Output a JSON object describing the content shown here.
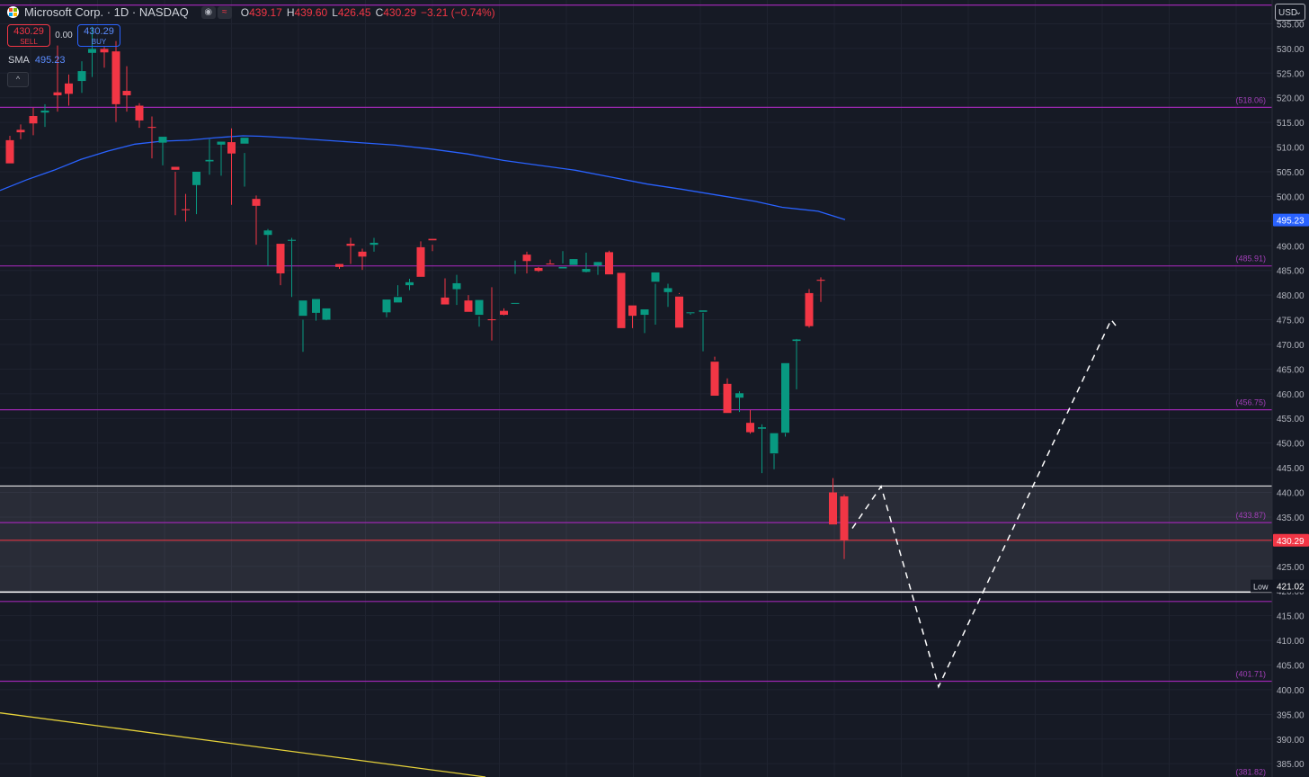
{
  "header": {
    "symbol": "Microsoft Corp. · 1D · NASDAQ",
    "open_label": "O",
    "open": "439.17",
    "high_label": "H",
    "high": "439.60",
    "low_label": "L",
    "low": "426.45",
    "close_label": "C",
    "close": "430.29",
    "change": "−3.21 (−0.74%)"
  },
  "trade": {
    "sell_price": "430.29",
    "sell_label": "SELL",
    "spread": "0.00",
    "buy_price": "430.29",
    "buy_label": "BUY"
  },
  "indicator": {
    "name": "SMA",
    "value": "495.23"
  },
  "currency": "USD",
  "colors": {
    "background": "#161a25",
    "grid": "#1f2330",
    "up": "#089981",
    "down": "#f23645",
    "sma": "#2962ff",
    "level": "#9c27b0",
    "trend": "#e6d23a"
  },
  "chart_data": {
    "type": "candlestick",
    "ylim": [
      382.3,
      539.8
    ],
    "y_ticks": [
      385,
      390,
      395,
      400,
      405,
      410,
      415,
      420,
      425,
      430,
      435,
      440,
      445,
      450,
      455,
      460,
      465,
      470,
      475,
      480,
      485,
      490,
      495,
      500,
      505,
      510,
      515,
      520,
      525,
      530,
      535
    ],
    "candles": [
      [
        511.4,
        512.3,
        507.2,
        506.7
      ],
      [
        513.5,
        514.6,
        511.6,
        513.0
      ],
      [
        516.3,
        518.0,
        512.4,
        514.8
      ],
      [
        517.0,
        518.7,
        514.1,
        517.4
      ],
      [
        521.1,
        530.6,
        517.2,
        520.5
      ],
      [
        522.9,
        524.7,
        518.4,
        520.8
      ],
      [
        523.4,
        527.4,
        521.0,
        525.4
      ],
      [
        529.1,
        534.4,
        524.2,
        529.9
      ],
      [
        529.9,
        526.1,
        530.3,
        529.2
      ],
      [
        529.4,
        531.5,
        515.1,
        518.7
      ],
      [
        521.4,
        526.4,
        517.2,
        520.5
      ],
      [
        518.4,
        518.9,
        513.9,
        515.4
      ],
      [
        514.1,
        516.2,
        507.7,
        513.9
      ],
      [
        510.9,
        511.3,
        506.3,
        512.1
      ],
      [
        506.0,
        505.0,
        496.2,
        505.4
      ],
      [
        497.4,
        500.5,
        494.9,
        497.2
      ],
      [
        502.3,
        503.8,
        496.4,
        505.0
      ],
      [
        507.1,
        511.6,
        504.4,
        507.4
      ],
      [
        510.5,
        511.1,
        504.2,
        511.1
      ],
      [
        511.0,
        513.8,
        498.3,
        508.7
      ],
      [
        510.7,
        502.0,
        508.8,
        511.9
      ],
      [
        499.5,
        500.2,
        490.2,
        498.1
      ],
      [
        492.2,
        493.4,
        485.9,
        493.1
      ],
      [
        490.4,
        490.0,
        482.0,
        484.4
      ],
      [
        491.0,
        491.6,
        479.6,
        491.2
      ],
      [
        475.8,
        475.0,
        468.5,
        478.9
      ],
      [
        476.4,
        477.2,
        474.8,
        479.2
      ],
      [
        475.0,
        476.8,
        474.9,
        477.3
      ],
      [
        486.3,
        486.3,
        485.3,
        485.7
      ],
      [
        490.4,
        486.3,
        491.6,
        490.0
      ],
      [
        488.8,
        489.4,
        485.1,
        487.8
      ],
      [
        490.2,
        491.6,
        488.8,
        490.6
      ],
      [
        476.5,
        477.0,
        475.5,
        479.1
      ],
      [
        478.5,
        482.0,
        479.8,
        479.6
      ],
      [
        482.0,
        483.3,
        481.0,
        482.6
      ],
      [
        489.7,
        486.5,
        490.9,
        483.7
      ],
      [
        491.4,
        490.2,
        488.9,
        491.1
      ],
      [
        479.5,
        483.4,
        478.2,
        478.1
      ],
      [
        481.2,
        484.1,
        478.0,
        482.4
      ],
      [
        478.9,
        480.0,
        478.7,
        476.6
      ],
      [
        476.0,
        473.6,
        475.7,
        479.0
      ],
      [
        475.1,
        481.6,
        470.8,
        474.9
      ],
      [
        476.8,
        477.3,
        475.9,
        476.0
      ],
      [
        478.3,
        484.3,
        487.0,
        478.4
      ],
      [
        488.2,
        488.8,
        484.4,
        486.9
      ],
      [
        485.5,
        485.7,
        484.7,
        484.9
      ],
      [
        486.4,
        487.2,
        486.3,
        486.2
      ],
      [
        485.4,
        488.9,
        486.4,
        485.7
      ],
      [
        486.1,
        486.6,
        487.3,
        487.3
      ],
      [
        484.7,
        488.6,
        484.6,
        485.3
      ],
      [
        486.0,
        484.1,
        486.7,
        486.7
      ],
      [
        488.7,
        489.0,
        488.0,
        484.2
      ],
      [
        484.5,
        484.3,
        473.5,
        473.3
      ],
      [
        477.9,
        477.2,
        473.3,
        475.8
      ],
      [
        476.0,
        476.1,
        472.3,
        477.1
      ],
      [
        482.7,
        482.3,
        474.0,
        484.6
      ],
      [
        480.6,
        482.3,
        477.6,
        481.4
      ],
      [
        479.7,
        480.2,
        480.4,
        473.4
      ],
      [
        476.4,
        476.3,
        476.0,
        476.5
      ],
      [
        476.6,
        476.4,
        468.6,
        476.9
      ],
      [
        466.5,
        467.5,
        466.8,
        459.6
      ],
      [
        462.0,
        463.1,
        456.4,
        456.1
      ],
      [
        459.2,
        460.5,
        456.3,
        460.1
      ],
      [
        454.1,
        456.7,
        451.9,
        452.2
      ],
      [
        452.9,
        453.8,
        443.9,
        453.2
      ],
      [
        447.9,
        447.8,
        444.7,
        452.0
      ],
      [
        452.1,
        452.0,
        451.3,
        466.2
      ],
      [
        470.7,
        471.1,
        460.9,
        471.0
      ],
      [
        480.4,
        481.2,
        473.4,
        473.7
      ],
      [
        483.1,
        483.6,
        478.6,
        482.9
      ],
      [
        440.0,
        442.9,
        436.2,
        433.5
      ],
      [
        439.2,
        439.6,
        426.5,
        430.3
      ]
    ],
    "candle_x": [
      11.0,
      23.0,
      37.0,
      50.0,
      64.0,
      76.5,
      91.0,
      102.5,
      116.0,
      129.0,
      141.0,
      155.0,
      169.0,
      181.0,
      195.0,
      206.5,
      218.5,
      233.0,
      246.0,
      257.5,
      272.0,
      285.0,
      298.0,
      312.0,
      324.5,
      337.0,
      351.5,
      363.0,
      377.5,
      390.0,
      403.0,
      416.0,
      430.0,
      442.5,
      455.5,
      468.0,
      481.0,
      495.0,
      508.0,
      521.0,
      533.0,
      547.0,
      560.5,
      573.0,
      586.0,
      599.0,
      612.0,
      626.0,
      638.0,
      652.0,
      665.0,
      677.5,
      691.0,
      703.5,
      717.0,
      729.0,
      743.0,
      755.5,
      768.0,
      782.0,
      795.0,
      809.0,
      822.5,
      834.5,
      847.5,
      861.0,
      873.5,
      886.0,
      900.0,
      913.0,
      926.5,
      939.0
    ],
    "sma": [
      [
        0.0,
        501.2
      ],
      [
        30.0,
        503.4
      ],
      [
        60.0,
        505.3
      ],
      [
        90.0,
        507.5
      ],
      [
        120.0,
        509.2
      ],
      [
        150.0,
        510.6
      ],
      [
        180.0,
        511.2
      ],
      [
        210.0,
        511.4
      ],
      [
        240.0,
        511.9
      ],
      [
        270.0,
        512.3
      ],
      [
        290.0,
        512.2
      ],
      [
        320.0,
        511.9
      ],
      [
        360.0,
        511.4
      ],
      [
        400.0,
        510.9
      ],
      [
        440.0,
        510.4
      ],
      [
        480.0,
        509.6
      ],
      [
        520.0,
        508.6
      ],
      [
        560.0,
        507.3
      ],
      [
        600.0,
        506.3
      ],
      [
        640.0,
        505.3
      ],
      [
        680.0,
        503.9
      ],
      [
        720.0,
        502.5
      ],
      [
        760.0,
        501.4
      ],
      [
        800.0,
        500.2
      ],
      [
        840.0,
        499.0
      ],
      [
        870.0,
        497.8
      ],
      [
        910.0,
        497.0
      ],
      [
        940.0,
        495.3
      ]
    ],
    "levels": [
      {
        "value": 538.8,
        "tag": ""
      },
      {
        "value": 518.06,
        "tag": "(518.06)"
      },
      {
        "value": 485.91,
        "tag": "(485.91)"
      },
      {
        "value": 456.75,
        "tag": "(456.75)"
      },
      {
        "value": 433.87,
        "tag": "(433.87)"
      },
      {
        "value": 417.89,
        "tag": ""
      },
      {
        "value": 401.71,
        "tag": "(401.71)"
      },
      {
        "value": 381.82,
        "tag": "(381.82)"
      }
    ],
    "zone": [
      419.8,
      441.3
    ],
    "price_line": 430.29,
    "price_label": "430.29",
    "sma_label": "495.23",
    "low_marker": {
      "value": 421.02,
      "label": "421.02",
      "tag": "Low"
    },
    "projection": [
      [
        948.0,
        432.7
      ],
      [
        980.0,
        441.2
      ],
      [
        1044.0,
        400.6
      ],
      [
        1236.0,
        475.0
      ],
      [
        1241.0,
        473.8
      ]
    ],
    "trendline": [
      [
        0.0,
        395.3
      ],
      [
        540.0,
        382.3
      ]
    ]
  }
}
